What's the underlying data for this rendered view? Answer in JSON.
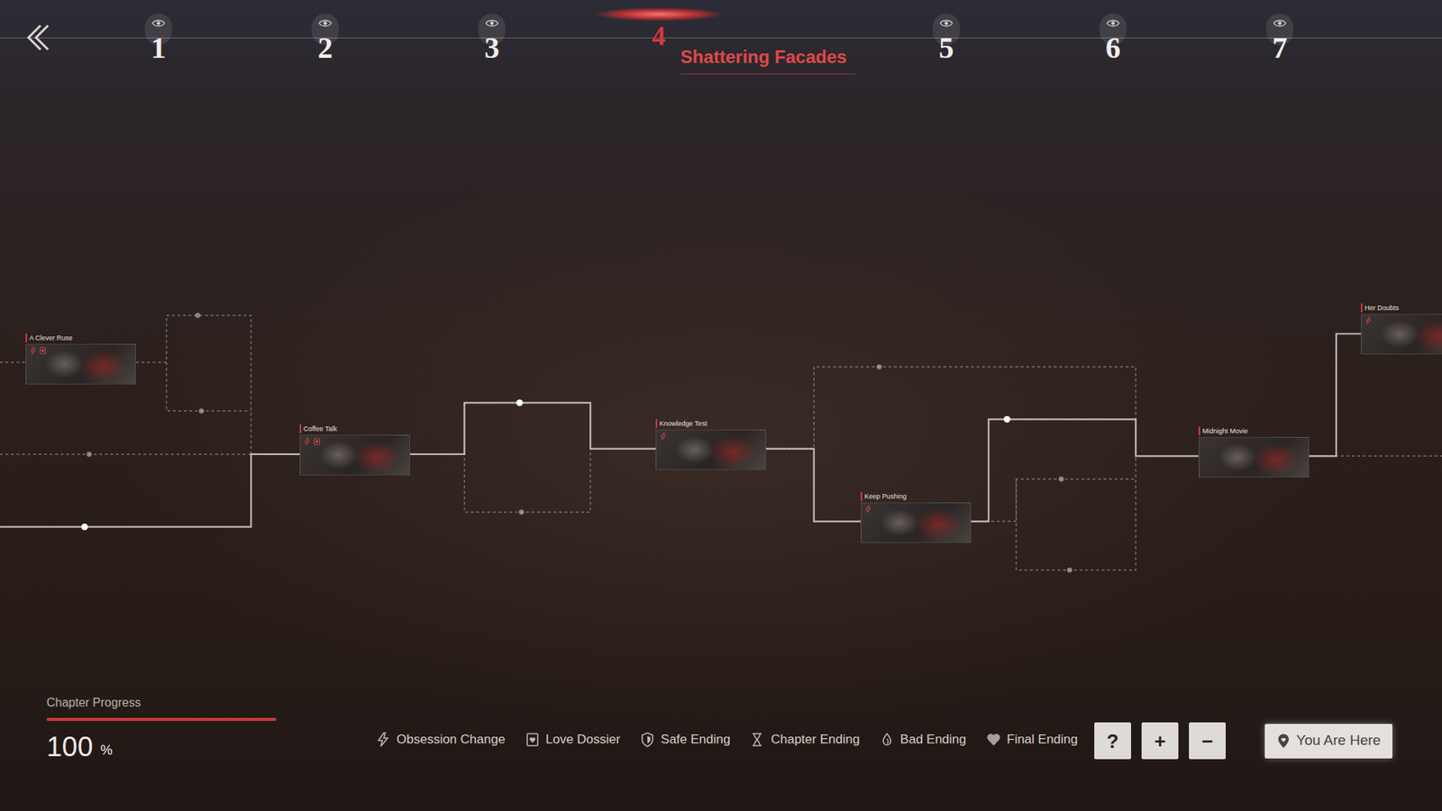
{
  "chapters": [
    {
      "number": "1",
      "selected": false
    },
    {
      "number": "2",
      "selected": false
    },
    {
      "number": "3",
      "selected": false
    },
    {
      "number": "4",
      "title": "Shattering Facades",
      "selected": true
    },
    {
      "number": "5",
      "selected": false
    },
    {
      "number": "6",
      "selected": false
    },
    {
      "number": "7",
      "selected": false
    }
  ],
  "nodes": [
    {
      "title": "A Clever Ruse",
      "markers": [
        {
          "kind": "obsession"
        },
        {
          "kind": "dossier"
        }
      ]
    },
    {
      "title": "Coffee Talk",
      "markers": [
        {
          "kind": "obsession"
        },
        {
          "kind": "dossier"
        }
      ]
    },
    {
      "title": "Knowledge Test",
      "markers": [
        {
          "kind": "obsession"
        }
      ]
    },
    {
      "title": "Keep Pushing",
      "markers": [
        {
          "kind": "obsession"
        }
      ]
    },
    {
      "title": "Midnight Movie",
      "markers": []
    },
    {
      "title": "Her Doubts",
      "markers": [
        {
          "kind": "obsession"
        }
      ]
    }
  ],
  "routes": [
    {
      "explored": true
    },
    {
      "explored": true
    },
    {
      "explored": true
    },
    {
      "explored": true
    },
    {
      "explored": true
    },
    {
      "explored": false
    },
    {
      "explored": false
    },
    {
      "explored": false
    },
    {
      "explored": false
    },
    {
      "explored": false
    },
    {
      "explored": false
    },
    {
      "explored": false
    },
    {
      "explored": false
    }
  ],
  "progress": {
    "label": "Chapter Progress",
    "value": "100",
    "unit": "%",
    "level": 1
  },
  "legend": [
    {
      "label": "Obsession Change",
      "kind": "obsession"
    },
    {
      "label": "Love Dossier",
      "kind": "dossier"
    },
    {
      "label": "Safe Ending",
      "kind": "safe"
    },
    {
      "label": "Chapter Ending",
      "kind": "chapter"
    },
    {
      "label": "Bad Ending",
      "kind": "bad"
    },
    {
      "label": "Final Ending",
      "kind": "final"
    }
  ],
  "controls": [
    {
      "label": "?"
    },
    {
      "label": "+"
    },
    {
      "label": "−"
    }
  ],
  "locate": {
    "label": "You Are Here"
  }
}
